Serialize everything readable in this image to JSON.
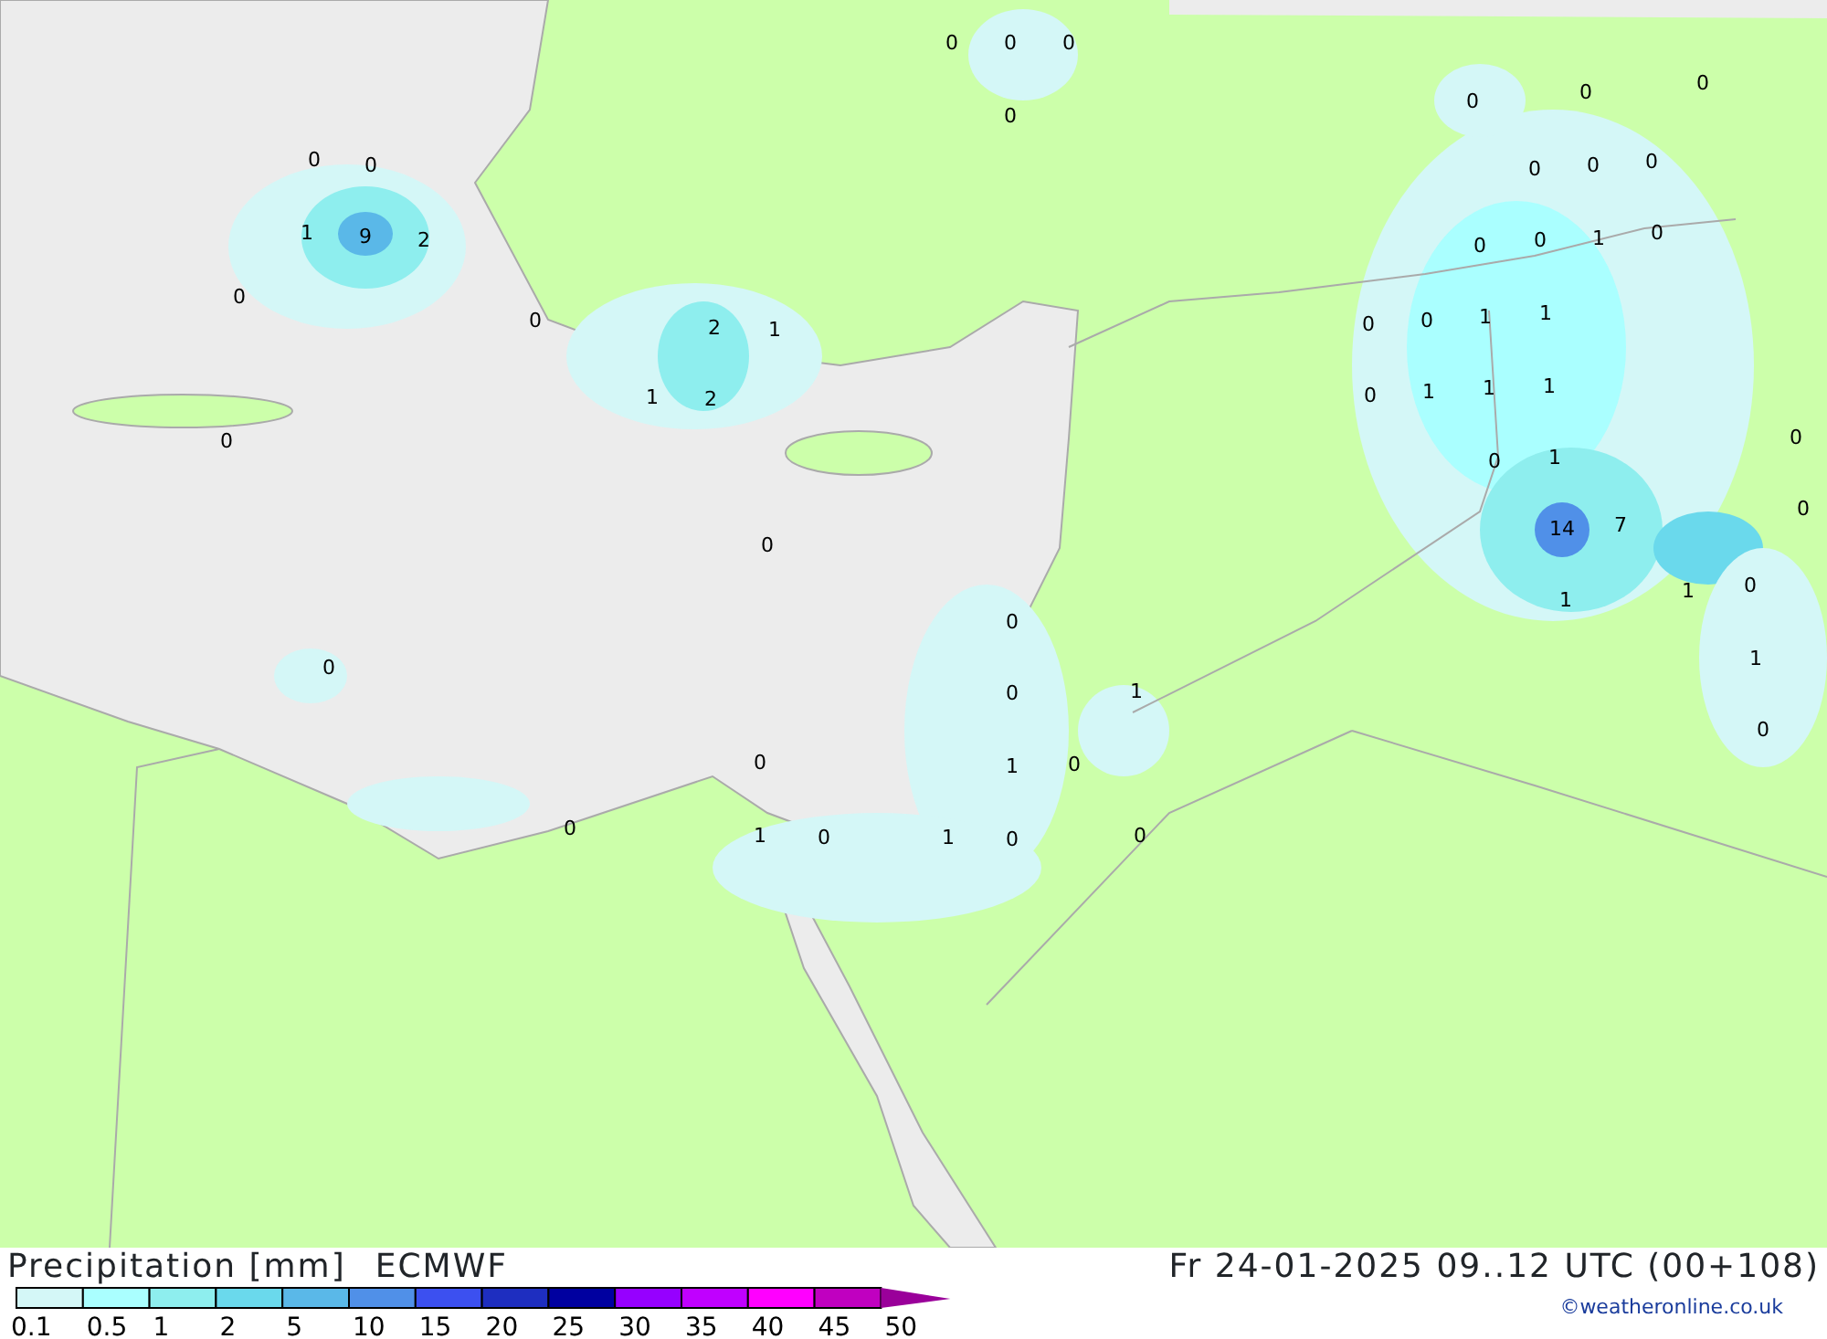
{
  "map": {
    "value_labels": [
      "0",
      "0",
      "0",
      "0",
      "0",
      "0",
      "0",
      "0",
      "0",
      "1",
      "9",
      "2",
      "0",
      "0",
      "2",
      "1",
      "1",
      "2",
      "0",
      "0",
      "0",
      "0",
      "0",
      "0",
      "1",
      "0",
      "0",
      "0",
      "1",
      "1",
      "0",
      "1",
      "1",
      "1",
      "0",
      "1",
      "14",
      "7",
      "1",
      "1",
      "0",
      "0",
      "0",
      "1",
      "0",
      "0",
      "0",
      "0",
      "0",
      "1",
      "0",
      "1",
      "0",
      "0",
      "1",
      "0",
      "1",
      "0",
      "0"
    ]
  },
  "footer": {
    "title": "Precipitation [mm]",
    "model": "ECMWF",
    "valid_time": "Fr 24-01-2025 09..12 UTC (00+108)",
    "credit": "©weatheronline.co.uk",
    "legend": [
      {
        "label": "0.1",
        "color": "#d4f7f7"
      },
      {
        "label": "0.5",
        "color": "#aaffff"
      },
      {
        "label": "1",
        "color": "#8eeeee"
      },
      {
        "label": "2",
        "color": "#6ad9ec"
      },
      {
        "label": "5",
        "color": "#5ab8e8"
      },
      {
        "label": "10",
        "color": "#5090e8"
      },
      {
        "label": "15",
        "color": "#3c50f0"
      },
      {
        "label": "20",
        "color": "#1e2ec0"
      },
      {
        "label": "25",
        "color": "#0000a0"
      },
      {
        "label": "30",
        "color": "#9600ff"
      },
      {
        "label": "35",
        "color": "#c000ff"
      },
      {
        "label": "40",
        "color": "#ff00ff"
      },
      {
        "label": "45",
        "color": "#c000c0"
      },
      {
        "label": "50",
        "color": "#9a009a"
      }
    ]
  }
}
